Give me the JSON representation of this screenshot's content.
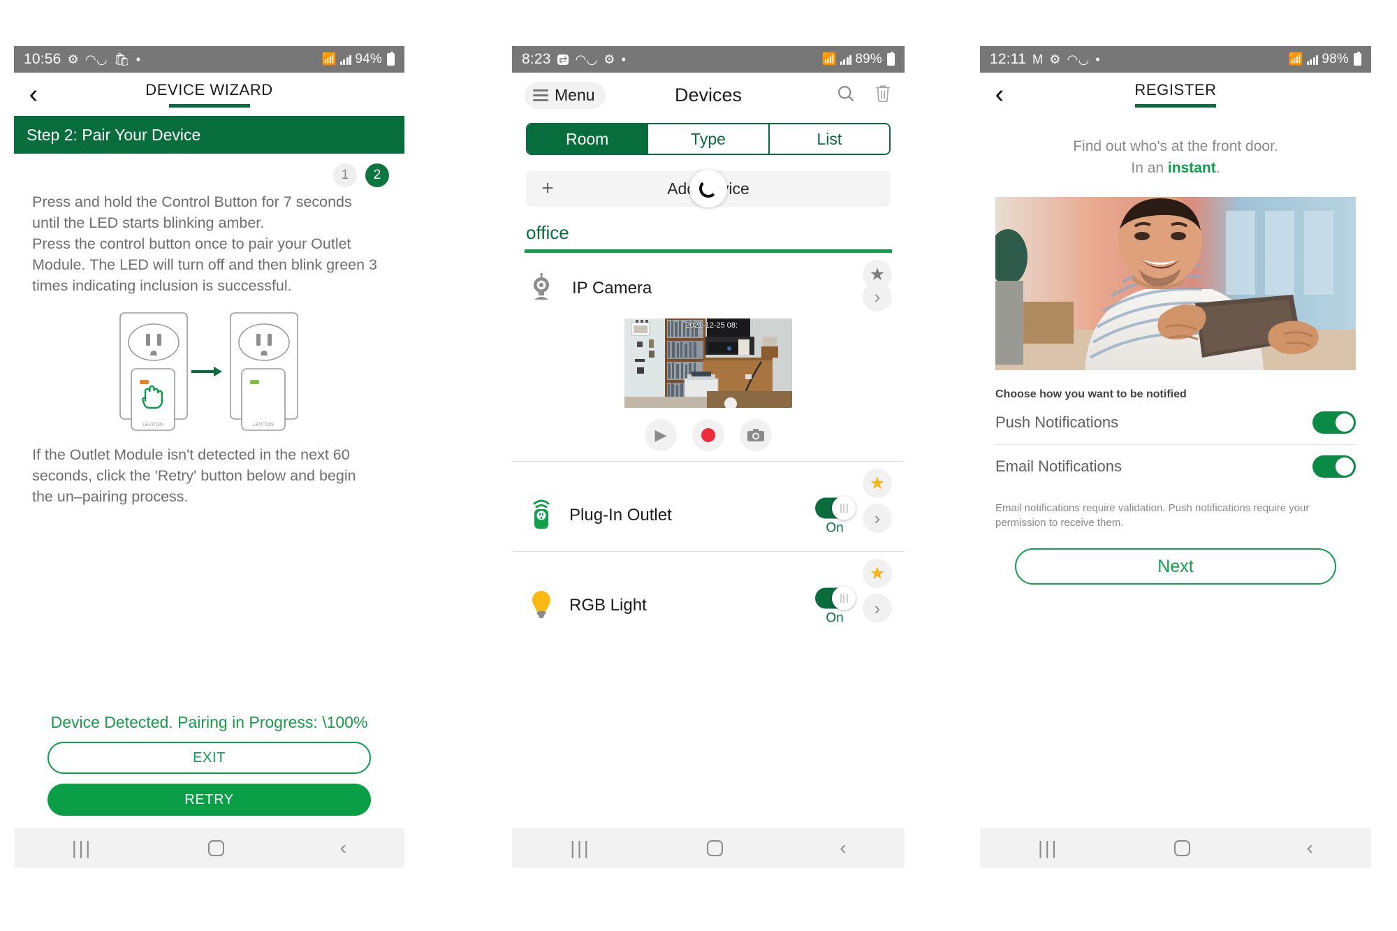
{
  "panel1": {
    "status": {
      "time": "10:56",
      "icons": [
        "gear-icon",
        "voicemail-icon",
        "bag-icon",
        "dot-icon"
      ],
      "battery": "94%"
    },
    "appbar": {
      "back": "‹",
      "title": "DEVICE WIZARD"
    },
    "step_banner": "Step 2: Pair Your Device",
    "steps": [
      {
        "label": "1",
        "active": false
      },
      {
        "label": "2",
        "active": true
      }
    ],
    "instructions_top": "Press and hold the Control Button for 7 seconds\nuntil the LED starts blinking amber.\nPress the control button once to pair your Outlet\nModule. The LED will turn off and then blink green 3\ntimes indicating inclusion is successful.",
    "instructions_bottom": "If the Outlet Module isn't detected in the next 60\nseconds, click the 'Retry' button below and begin\nthe un–pairing process.",
    "diagram": {
      "left_led_color": "#e8832a",
      "right_led_color": "#7dc242",
      "brand": "LEVITON",
      "arrow": "→"
    },
    "progress_text": "Device Detected. Pairing in Progress: \\100%",
    "buttons": {
      "exit": "EXIT",
      "retry": "RETRY"
    }
  },
  "panel2": {
    "status": {
      "time": "8:23",
      "icons": [
        "sync-icon",
        "voicemail-icon",
        "gear-icon",
        "dot-icon"
      ],
      "battery": "89%"
    },
    "appbar": {
      "menu": "Menu",
      "title": "Devices",
      "search": "search-icon",
      "trash": "trash-icon"
    },
    "tabs": [
      {
        "label": "Room",
        "active": true
      },
      {
        "label": "Type",
        "active": false
      },
      {
        "label": "List",
        "active": false
      }
    ],
    "add_device": {
      "plus": "+",
      "label": "Add Device",
      "loading": true
    },
    "room": "office",
    "devices": [
      {
        "name": "IP Camera",
        "icon": "ip-camera-icon",
        "favorite": false,
        "has_toggle": false,
        "camera": {
          "timestamp": "2021-12-25 08:",
          "controls": [
            {
              "name": "play-button",
              "glyph": "▶"
            },
            {
              "name": "record-button",
              "glyph": ""
            },
            {
              "name": "snapshot-button",
              "glyph": "▣"
            }
          ]
        }
      },
      {
        "name": "Plug-In Outlet",
        "icon": "plug-in-outlet-icon",
        "favorite": true,
        "has_toggle": true,
        "toggle_state": "On"
      },
      {
        "name": "RGB Light",
        "icon": "light-bulb-icon",
        "favorite": true,
        "has_toggle": true,
        "toggle_state": "On"
      }
    ]
  },
  "panel3": {
    "status": {
      "time": "12:11",
      "icons": [
        "gmail-icon",
        "gear-icon",
        "voicemail-icon",
        "dot-icon"
      ],
      "battery": "98%"
    },
    "appbar": {
      "back": "‹",
      "title": "REGISTER"
    },
    "tagline_line1": "Find out who's at the front door.",
    "tagline_line2_prefix": "In an ",
    "tagline_line2_accent": "instant",
    "tagline_line2_suffix": ".",
    "section_title": "Choose how you want to be notified",
    "notifications": [
      {
        "label": "Push Notifications",
        "on": true
      },
      {
        "label": "Email Notifications",
        "on": true
      }
    ],
    "note": "Email notifications require validation. Push notifications require your permission to receive them.",
    "next_button": "Next"
  },
  "navbar": {
    "recent": "|||",
    "home": "home-icon",
    "back": "‹"
  },
  "colors": {
    "brand_green_dark": "#076d3c",
    "brand_green": "#0fa04c",
    "accent_gold": "#f5b417",
    "record_red": "#ef2b3d",
    "status_grey": "#777777",
    "text_grey": "#6e6e6e"
  }
}
